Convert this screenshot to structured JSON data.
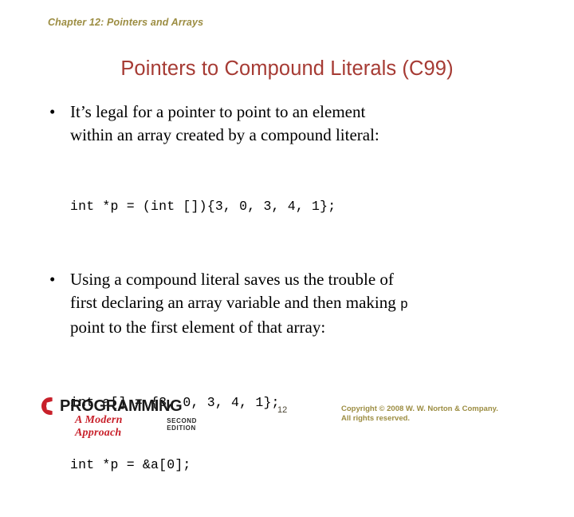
{
  "slide": {
    "chapter_header": "Chapter 12: Pointers and Arrays",
    "title": "Pointers to Compound Literals (C99)",
    "colors": {
      "header_olive": "#9c8d42",
      "title_red": "#a63b34",
      "logo_red": "#c8202a",
      "body_black": "#000000",
      "background": "#ffffff"
    }
  },
  "body": {
    "bullet1": {
      "line1": "It’s legal for a pointer to point to an element",
      "line2": "within an array created by a compound literal:"
    },
    "code1": {
      "line1": "int *p = (int []){3, 0, 3, 4, 1};"
    },
    "bullet2": {
      "line1": "Using a compound literal saves us the trouble of",
      "line2a": "first declaring an array variable and then making ",
      "line2_code": "p",
      "line3": "point to the first element of that array:"
    },
    "code2": {
      "line1": "int a[] = {3, 0, 3, 4, 1};",
      "line2": "int *p = &a[0];"
    },
    "bullet_marker": "•"
  },
  "footer": {
    "logo": {
      "letter": "C",
      "word": "PROGRAMMING",
      "tagline": "A Modern Approach",
      "edition": "SECOND EDITION"
    },
    "page_number": "12",
    "copyright_line1": "Copyright © 2008 W. W. Norton & Company.",
    "copyright_line2": "All rights reserved."
  }
}
